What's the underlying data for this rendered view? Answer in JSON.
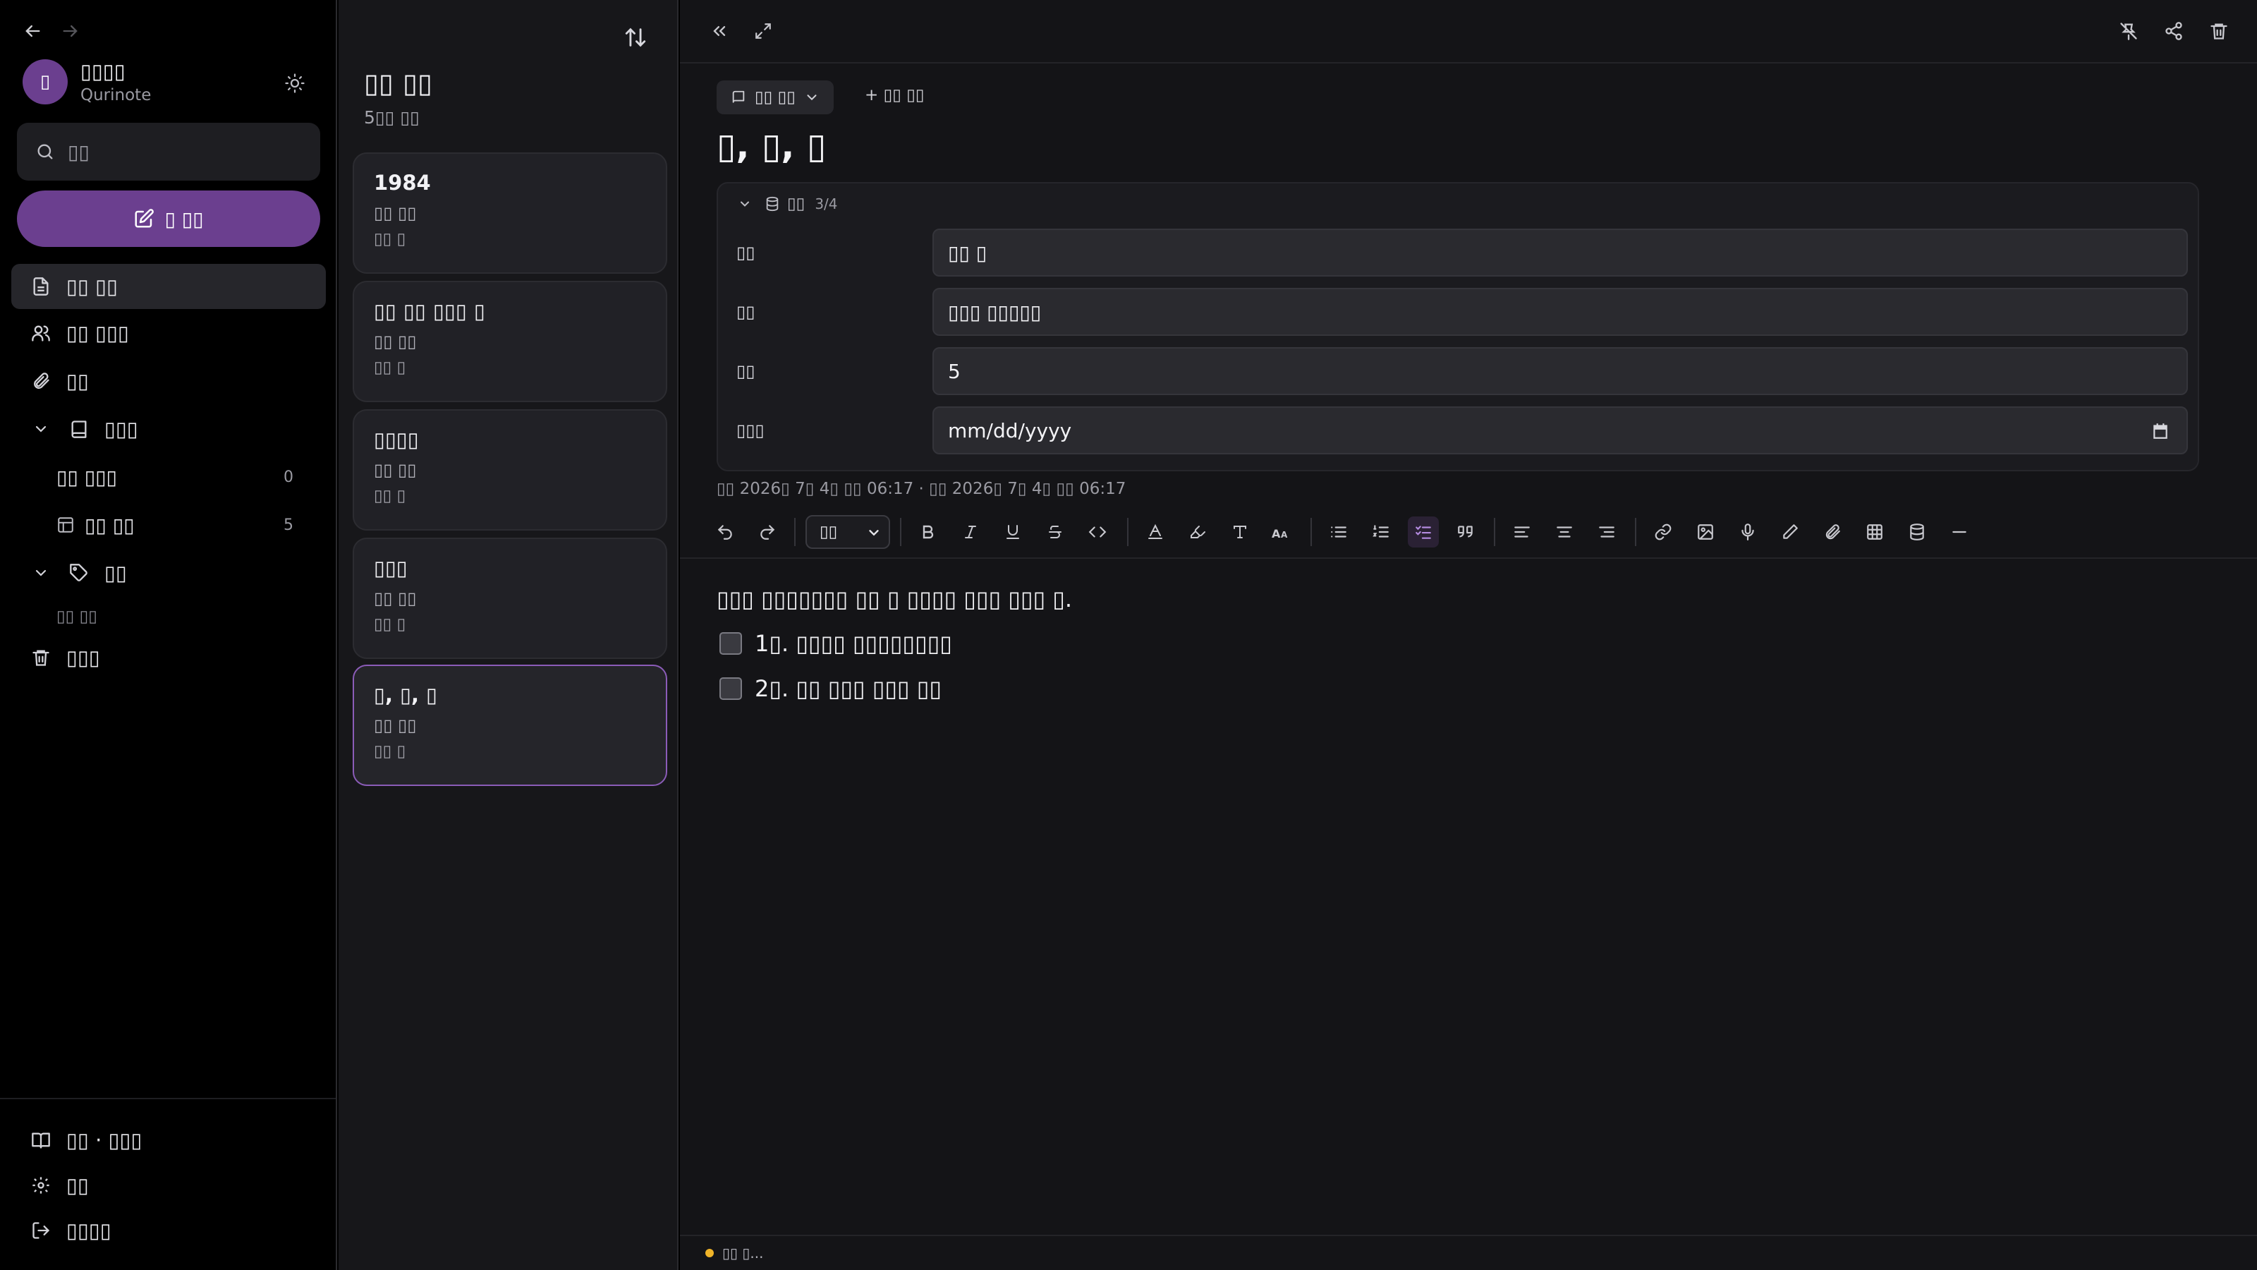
{
  "sidebar": {
    "profile": {
      "avatar_glyph": "▯",
      "name": "▯▯▯▯",
      "app": "Qurinote"
    },
    "search_placeholder": "▯▯",
    "new_note_label": "▯ ▯▯",
    "nav": [
      {
        "label": "▯▯ ▯▯",
        "icon": "document-icon",
        "active": true
      },
      {
        "label": "▯▯ ▯▯▯",
        "icon": "users-icon",
        "active": false
      },
      {
        "label": "▯▯",
        "icon": "paperclip-icon",
        "active": false
      }
    ],
    "notebooks": {
      "label": "▯▯▯",
      "items": [
        {
          "label": "▯▯ ▯▯▯",
          "count": "0"
        },
        {
          "label": "▯▯ ▯▯",
          "count": "5",
          "icon": "table-icon"
        }
      ]
    },
    "tags": {
      "label": "▯▯",
      "empty": "▯▯ ▯▯"
    },
    "trash_label": "▯▯▯",
    "footer": [
      {
        "label": "▯▯ · ▯▯▯",
        "icon": "book-icon"
      },
      {
        "label": "▯▯",
        "icon": "gear-icon"
      },
      {
        "label": "▯▯▯▯",
        "icon": "logout-icon"
      }
    ]
  },
  "list": {
    "title": "▯▯ ▯▯",
    "count": "5▯▯ ▯▯",
    "notes": [
      {
        "title": "1984",
        "author": "▯▯ ▯▯",
        "status": "▯▯ ▯",
        "selected": false
      },
      {
        "title": "▯▯ ▯▯ ▯▯▯ ▯",
        "author": "▯▯ ▯▯",
        "status": "▯▯ ▯",
        "selected": false
      },
      {
        "title": "▯▯▯▯",
        "author": "▯▯ ▯▯",
        "status": "▯▯ ▯",
        "selected": false
      },
      {
        "title": "▯▯▯",
        "author": "▯▯ ▯▯",
        "status": "▯▯ ▯",
        "selected": false
      },
      {
        "title": "▯, ▯, ▯",
        "author": "▯▯ ▯▯",
        "status": "▯▯ ▯",
        "selected": true
      }
    ]
  },
  "editor": {
    "notebook_pill": "▯▯ ▯▯",
    "add_property": "+ ▯▯ ▯▯",
    "title": "▯, ▯, ▯",
    "properties": {
      "header": "▯▯",
      "count": "3/4",
      "rows": [
        {
          "label": "▯▯",
          "value": "▯▯ ▯"
        },
        {
          "label": "▯▯",
          "value": "▯▯▯ ▯▯▯▯▯"
        },
        {
          "label": "▯▯",
          "value": "5"
        },
        {
          "label": "▯▯▯",
          "value": "mm/dd/yyyy"
        }
      ]
    },
    "timestamps": "▯▯ 2026▯ 7▯ 4▯ ▯▯ 06:17 · ▯▯ 2026▯ 7▯ 4▯ ▯▯ 06:17",
    "style_select": "▯▯",
    "body": {
      "paragraph": "▯▯▯ ▯▯▯▯▯▯▯ ▯▯ ▯ ▯▯▯▯ ▯▯▯ ▯▯▯ ▯.",
      "tasks": [
        {
          "text": "1▯. ▯▯▯▯ ▯▯▯▯▯▯▯▯",
          "checked": false
        },
        {
          "text": "2▯. ▯▯ ▯▯▯ ▯▯▯ ▯▯",
          "checked": false
        }
      ]
    },
    "status": "▯▯ ▯..."
  },
  "colors": {
    "accent": "#6b3f8f",
    "selected_border": "#8b5cb8",
    "status_dot": "#f0b429"
  }
}
